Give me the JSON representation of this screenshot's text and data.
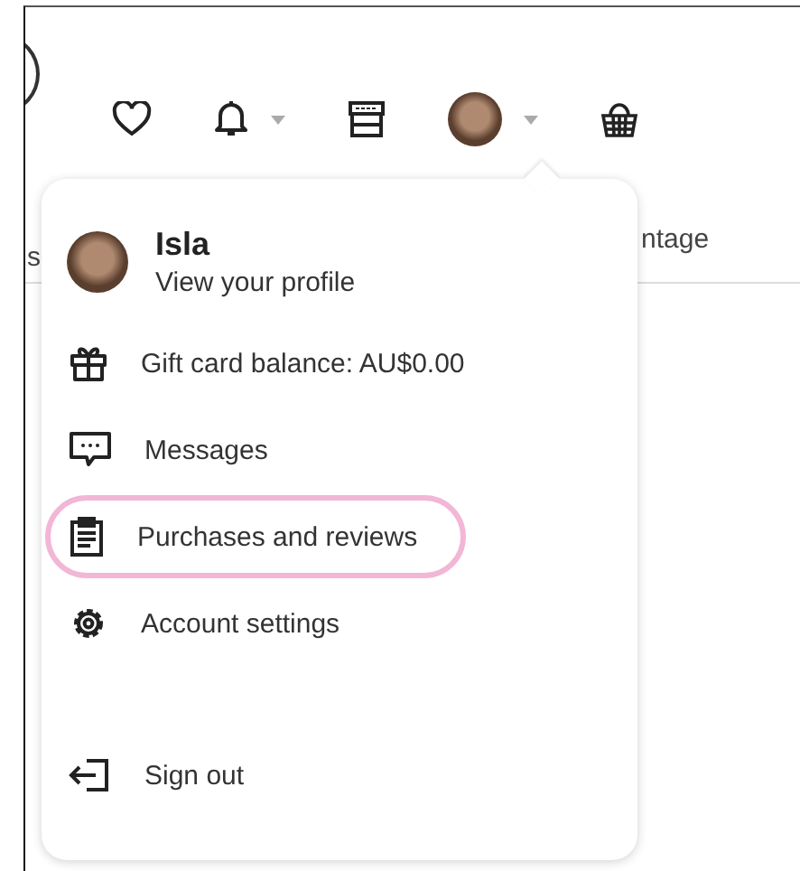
{
  "header": {
    "nav_left_text": "s",
    "nav_right_text": "ntage"
  },
  "account_menu": {
    "profile": {
      "name": "Isla",
      "link": "View your profile"
    },
    "items": [
      {
        "kind": "gift",
        "label": "Gift card balance: AU$0.00",
        "highlighted": false
      },
      {
        "kind": "messages",
        "label": "Messages",
        "highlighted": false
      },
      {
        "kind": "purchases",
        "label": "Purchases and reviews",
        "highlighted": true
      },
      {
        "kind": "settings",
        "label": "Account settings",
        "highlighted": false
      },
      {
        "kind": "signout",
        "label": "Sign out",
        "highlighted": false
      }
    ]
  }
}
